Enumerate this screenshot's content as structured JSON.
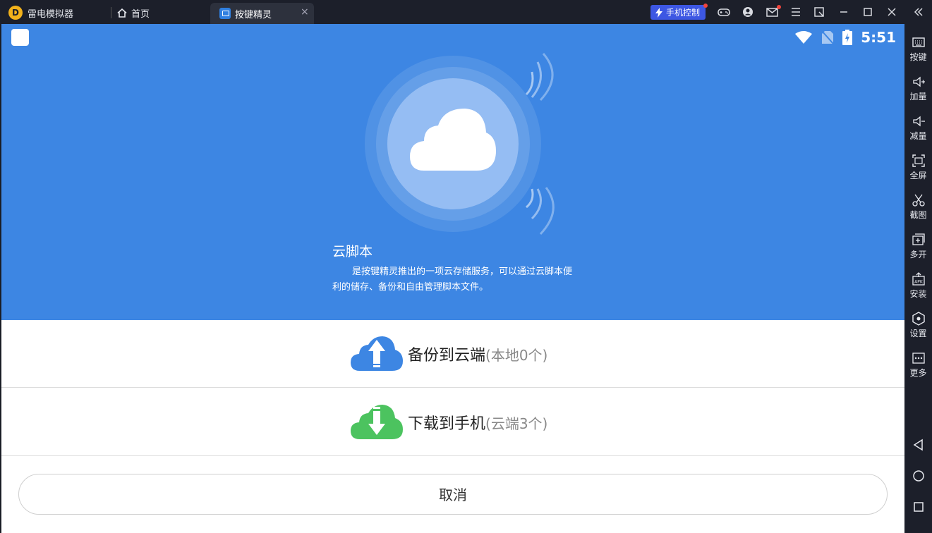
{
  "titlebar": {
    "logo_letter": "D",
    "app_name": "雷电模拟器",
    "home_tab": "首页",
    "active_tab": "按键精灵",
    "close_symbol": "×",
    "phone_control": "手机控制"
  },
  "status": {
    "time": "5:51"
  },
  "hero": {
    "title": "云脚本",
    "description": "是按键精灵推出的一项云存储服务，可以通过云脚本便利的储存、备份和自由管理脚本文件。"
  },
  "actions": {
    "backup_main": "备份到云端",
    "backup_sub": "(本地0个)",
    "download_main": "下载到手机",
    "download_sub": "(云端3个)"
  },
  "cancel_label": "取消",
  "sidebar": {
    "keys": "按键",
    "vol_up": "加量",
    "vol_down": "减量",
    "fullscreen": "全屏",
    "screenshot": "截图",
    "multi": "多开",
    "install": "安装",
    "settings": "设置",
    "more": "更多"
  },
  "colors": {
    "hero_bg": "#3d86e3",
    "upload_blue": "#3d86e3",
    "download_green": "#4cc35f"
  }
}
